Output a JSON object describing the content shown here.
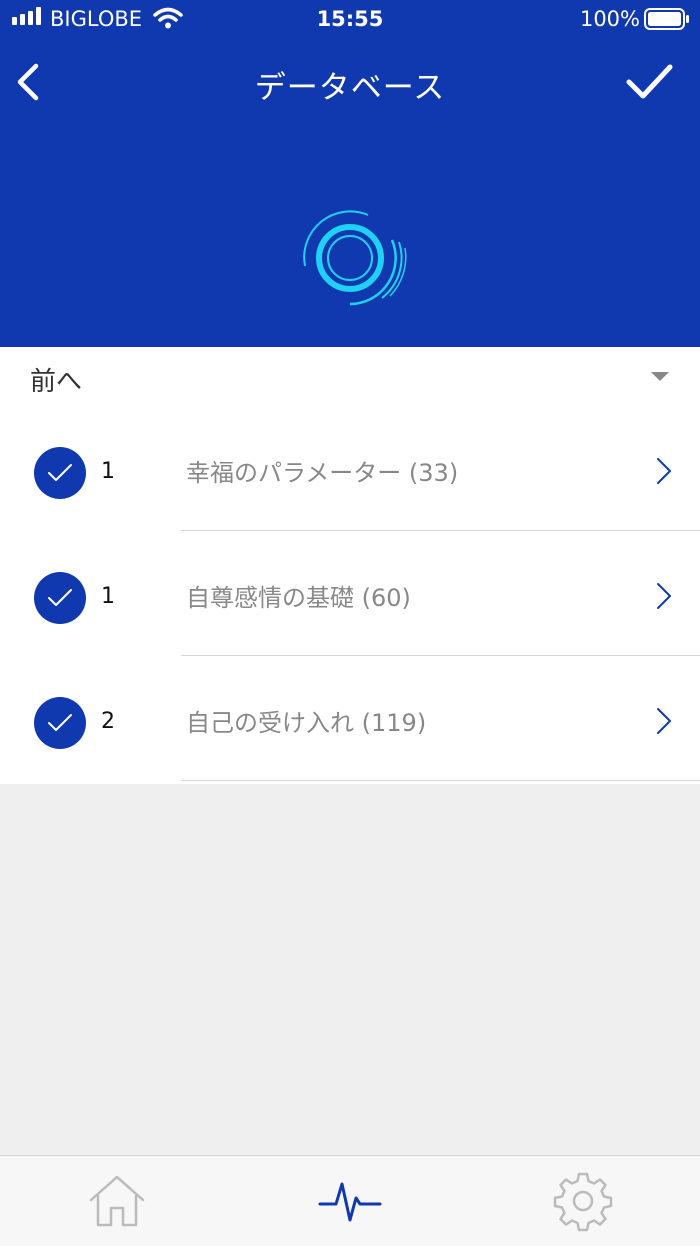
{
  "status_bar": {
    "carrier": "BIGLOBE",
    "time": "15:55",
    "battery": "100%"
  },
  "header": {
    "title": "データベース"
  },
  "filter": {
    "label": "前へ"
  },
  "items": [
    {
      "count": "1",
      "label": "幸福のパラメーター",
      "total": "(33)"
    },
    {
      "count": "1",
      "label": "自尊感情の基礎",
      "total": "(60)"
    },
    {
      "count": "2",
      "label": "自己の受け入れ",
      "total": "(119)"
    }
  ],
  "tabbar": {
    "tabs": [
      {
        "icon": "home-icon",
        "active": false
      },
      {
        "icon": "pulse-icon",
        "active": true
      },
      {
        "icon": "gear-icon",
        "active": false
      }
    ]
  },
  "colors": {
    "primary": "#1039b0",
    "accent": "#1fd1f5",
    "background": "#efefef"
  }
}
